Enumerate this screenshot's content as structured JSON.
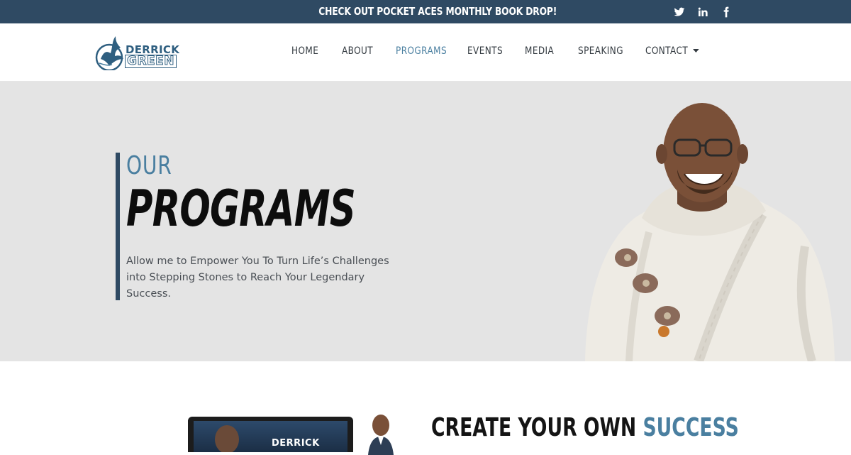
{
  "announcement": {
    "text": "CHECK OUT POCKET ACES MONTHLY BOOK DROP!"
  },
  "social": [
    {
      "icon": "twitter-icon"
    },
    {
      "icon": "linkedin-icon"
    },
    {
      "icon": "facebook-icon"
    }
  ],
  "logo": {
    "line1": "DERRICK",
    "line2": "GREEN"
  },
  "nav": {
    "items": [
      "HOME",
      "ABOUT",
      "PROGRAMS",
      "EVENTS",
      "MEDIA",
      "SPEAKING",
      "CONTACT"
    ],
    "active": "PROGRAMS"
  },
  "hero": {
    "kicker": "OUR",
    "title": "PROGRAMS",
    "description": "Allow me to Empower You To Turn Life’s Challenges into Stepping Stones to Reach Your Legendary Success."
  },
  "section": {
    "title_part1": "CREATE YOUR OWN ",
    "title_accent": "SUCCESS",
    "laptop_brand": "DERRICK"
  },
  "colors": {
    "primary": "#2f4a63",
    "accent": "#4a7fa0",
    "hero_bg": "#e4e4e4"
  }
}
